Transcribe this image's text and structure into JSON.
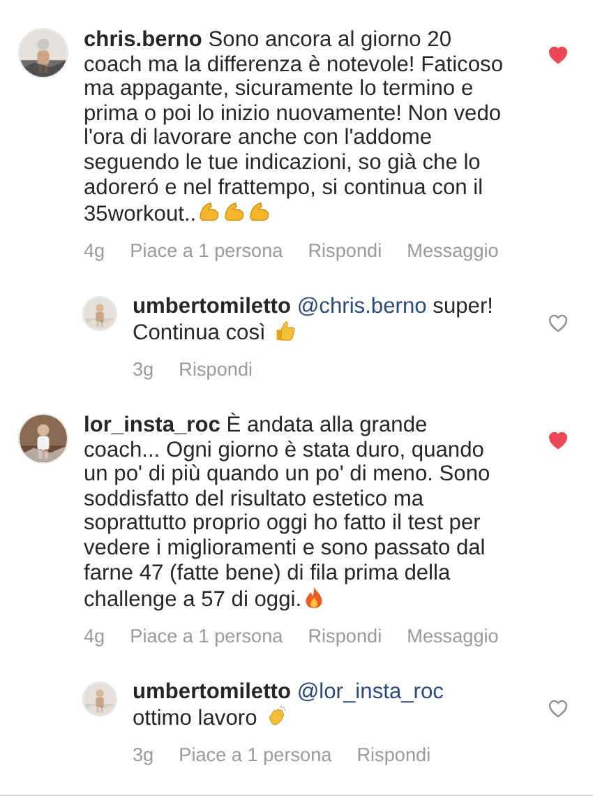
{
  "comments": [
    {
      "kind": "comment",
      "text": "**chris.berno** Sono ancora al giorno 20 coach ma la differenza è notevole! Faticoso ma appagante, sicuramente lo termino e prima o poi lo inizio nuovamente! Non vedo l'ora di lavorare anche con l'addome seguendo le tue indicazioni, so già che lo adoreró e nel frattempo, si continua con il 35workout..",
      "emojis": [
        {
          "kind": "muscle"
        },
        {
          "kind": "muscle"
        },
        {
          "kind": "muscle"
        }
      ],
      "liked": true,
      "actions": [
        "4g",
        "Piace a 1 persona",
        "Rispondi",
        "Messaggio"
      ]
    },
    {
      "kind": "reply",
      "text": "**umbertomiletto**",
      "mention": "@chris.berno",
      "after": "super! Continua così",
      "emojis": [
        {
          "kind": "thumbs"
        }
      ],
      "liked": false,
      "actions": [
        "3g",
        "Rispondi"
      ]
    },
    {
      "kind": "comment",
      "text": "**lor_insta_roc** È andata alla grande coach... Ogni giorno è stata duro, quando un po' di più quando un po' di meno. Sono soddisfatto del risultato estetico ma soprattutto proprio oggi ho fatto il test per vedere i miglioramenti e sono passato dal farne 47 (fatte bene) di fila prima della challenge a 57 di oggi.",
      "emojis": [
        {
          "kind": "fire"
        }
      ],
      "liked": true,
      "actions": [
        "4g",
        "Piace a 1 persona",
        "Rispondi",
        "Messaggio"
      ]
    },
    {
      "kind": "reply",
      "text": "**umbertomiletto**",
      "mention": "@lor_insta_roc",
      "after": "ottimo lavoro",
      "emojis": [
        {
          "kind": "clap"
        }
      ],
      "liked": false,
      "actions": [
        "3g",
        "Piace a 1 persona",
        "Rispondi"
      ]
    }
  ]
}
